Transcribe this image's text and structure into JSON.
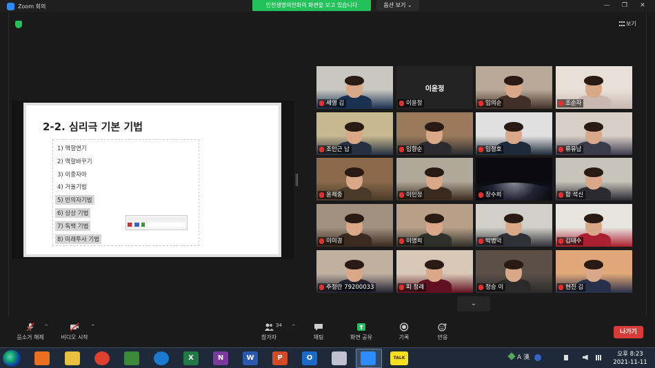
{
  "window": {
    "title": "Zoom 회의",
    "share_banner": "인천생명의전화의 화면을 보고 있습니다",
    "view_options": "옵션 보기 ⌄",
    "minimize": "—",
    "maximize": "❐",
    "close": "✕",
    "gallery_button": "보기"
  },
  "slide": {
    "title": "2-2. 심리극 기본 기법",
    "items": [
      {
        "text": "1) 역할연기",
        "highlight": false
      },
      {
        "text": "2) 역할바꾸기",
        "highlight": false
      },
      {
        "text": "3) 이중자아",
        "highlight": false
      },
      {
        "text": "4) 거울기법",
        "highlight": false
      },
      {
        "text": "5) 빈의자기법",
        "highlight": true
      },
      {
        "text": "6) 상상 기법",
        "highlight": true
      },
      {
        "text": "7) 독백 기법",
        "highlight": true
      },
      {
        "text": "8) 미래투사 기법",
        "highlight": true
      }
    ]
  },
  "participants": [
    {
      "name": "세영 김",
      "video": true
    },
    {
      "name": "이윤정",
      "video": false,
      "display_name": "이윤정"
    },
    {
      "name": "임의순",
      "video": true
    },
    {
      "name": "조순자",
      "video": true
    },
    {
      "name": "조인근 남",
      "video": true
    },
    {
      "name": "임향순",
      "video": true
    },
    {
      "name": "임정호",
      "video": true
    },
    {
      "name": "류유남",
      "video": true
    },
    {
      "name": "윤제중",
      "video": true
    },
    {
      "name": "이민정",
      "video": true
    },
    {
      "name": "장수희",
      "video": true
    },
    {
      "name": "함 석신",
      "video": true
    },
    {
      "name": "이미경",
      "video": true
    },
    {
      "name": "이명희",
      "video": true
    },
    {
      "name": "박병덕",
      "video": true
    },
    {
      "name": "김태수",
      "video": true
    },
    {
      "name": "주정란 79200033",
      "video": true
    },
    {
      "name": "피 정례",
      "video": true
    },
    {
      "name": "정승 이",
      "video": true
    },
    {
      "name": "현진 김",
      "video": true
    }
  ],
  "scroll_down": "⌄",
  "toolbar": {
    "mute": "음소거 해제",
    "video": "비디오 시작",
    "participants": "참가자",
    "participants_count": "34",
    "chat": "채팅",
    "share": "화면 공유",
    "record": "기록",
    "reactions": "반응",
    "leave": "나가기",
    "caret": "^"
  },
  "taskbar": {
    "tray_text": "A 漢",
    "time": "오후 8:23",
    "date": "2021-11-11",
    "apps": [
      "media-player",
      "file-explorer",
      "chrome",
      "network-users",
      "edge",
      "excel",
      "onenote",
      "word",
      "powerpoint",
      "outlook",
      "snipping",
      "zoom",
      "kakaotalk"
    ],
    "labels": {
      "excel": "X",
      "onenote": "N",
      "word": "W",
      "powerpoint": "P",
      "outlook": "O",
      "kakaotalk": "TALK"
    }
  },
  "colors": {
    "accent_green": "#23c15a",
    "leave_red": "#d83b37",
    "zoom_blue": "#2d8cff",
    "mic_muted": "#e03030"
  }
}
